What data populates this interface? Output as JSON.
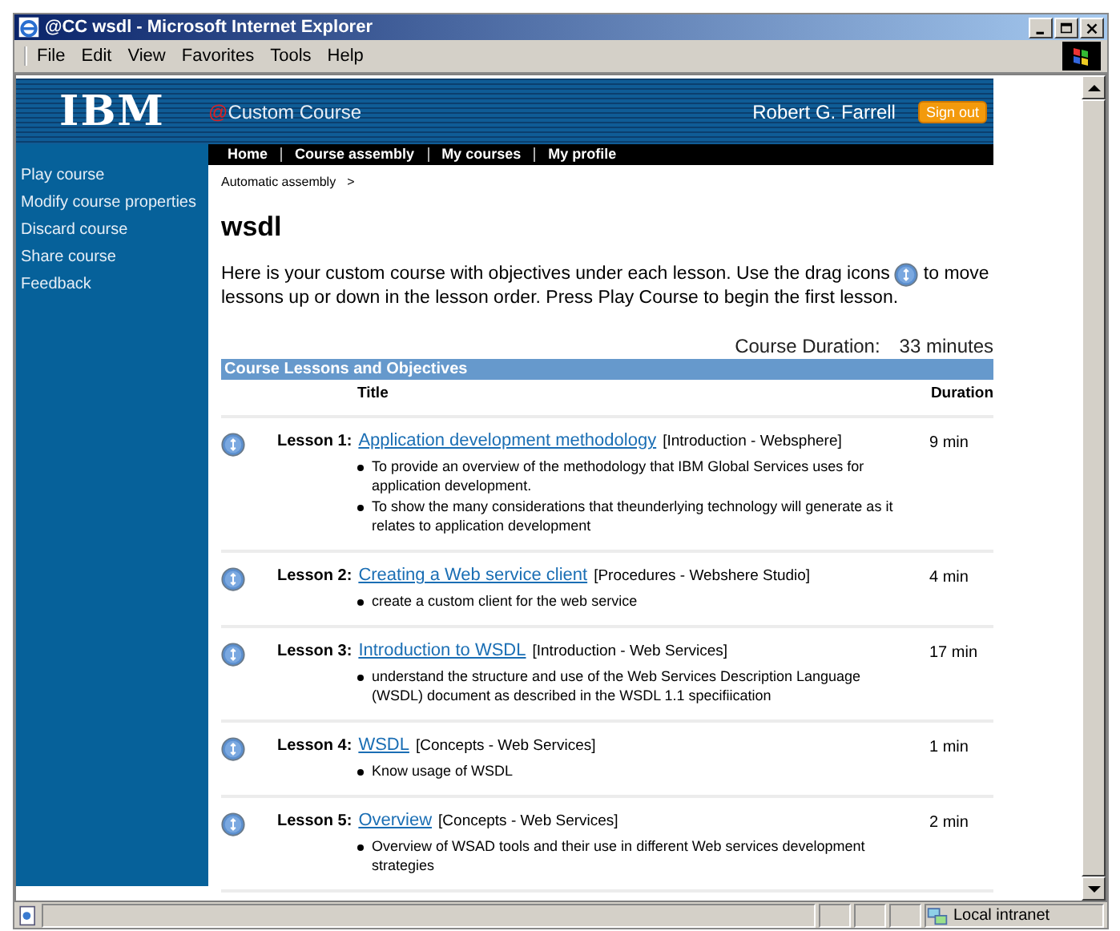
{
  "window": {
    "title": "@CC wsdl - Microsoft Internet Explorer"
  },
  "menu": [
    "File",
    "Edit",
    "View",
    "Favorites",
    "Tools",
    "Help"
  ],
  "header": {
    "logo": "IBM",
    "at_sign": "@",
    "site_title": "Custom Course",
    "user": "Robert G. Farrell",
    "sign_out": "Sign out"
  },
  "nav": [
    "Home",
    "Course assembly",
    "My courses",
    "My profile"
  ],
  "sidebar": {
    "items": [
      "Play course",
      "Modify course properties",
      "Discard course",
      "Share course",
      "Feedback"
    ]
  },
  "breadcrumb": {
    "item": "Automatic assembly",
    "separator": ">"
  },
  "heading": "wsdl",
  "intro": {
    "before": "Here is your custom course with objectives under each lesson. Use the drag icons",
    "after_icon": "to move",
    "second_line": "lessons up or down in the lesson order. Press Play Course to begin the first lesson."
  },
  "course_duration": {
    "label": "Course Duration:",
    "value": "33 minutes"
  },
  "table": {
    "caption": "Course Lessons and Objectives",
    "columns": [
      "Title",
      "Duration"
    ],
    "lessons": [
      {
        "label": "Lesson 1:",
        "title": "Application development methodology",
        "category": "[Introduction - Websphere]",
        "duration": "9 min",
        "objectives": [
          "To provide an overview of the methodology that IBM Global Services uses for application development.",
          "To show the many considerations that theunderlying technology will generate as it relates to application development"
        ]
      },
      {
        "label": "Lesson 2:",
        "title": "Creating a Web service client",
        "category": "[Procedures - Webshere Studio]",
        "duration": "4 min",
        "objectives": [
          "create a custom client for the web service"
        ]
      },
      {
        "label": "Lesson 3:",
        "title": "Introduction to WSDL",
        "category": "[Introduction - Web Services]",
        "duration": "17 min",
        "objectives": [
          "understand the structure and use of the Web Services Description Language (WSDL) document as described in the WSDL 1.1 specifiication"
        ]
      },
      {
        "label": "Lesson 4:",
        "title": "WSDL",
        "category": "[Concepts - Web Services]",
        "duration": "1 min",
        "objectives": [
          "Know usage of WSDL"
        ]
      },
      {
        "label": "Lesson 5:",
        "title": "Overview",
        "category": "[Concepts - Web Services]",
        "duration": "2 min",
        "objectives": [
          "Overview of WSAD tools and their use in different Web services development strategies"
        ]
      }
    ]
  },
  "status_bar": {
    "zone": "Local intranet"
  }
}
